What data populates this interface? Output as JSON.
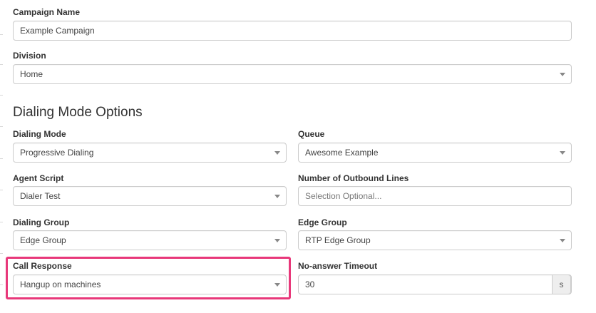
{
  "campaign": {
    "name_label": "Campaign Name",
    "name_value": "Example Campaign",
    "division_label": "Division",
    "division_value": "Home"
  },
  "section": {
    "title": "Dialing Mode Options"
  },
  "dialing": {
    "mode_label": "Dialing Mode",
    "mode_value": "Progressive Dialing",
    "queue_label": "Queue",
    "queue_value": "Awesome Example",
    "script_label": "Agent Script",
    "script_value": "Dialer Test",
    "lines_label": "Number of Outbound Lines",
    "lines_placeholder": "Selection Optional...",
    "group_label": "Dialing Group",
    "group_value": "Edge Group",
    "edge_label": "Edge Group",
    "edge_value": "RTP Edge Group",
    "response_label": "Call Response",
    "response_value": "Hangup on machines",
    "timeout_label": "No-answer Timeout",
    "timeout_value": "30",
    "timeout_unit": "s"
  },
  "colors": {
    "highlight": "#e8387a",
    "border": "#cccccc",
    "addon_bg": "#eeeeee"
  }
}
